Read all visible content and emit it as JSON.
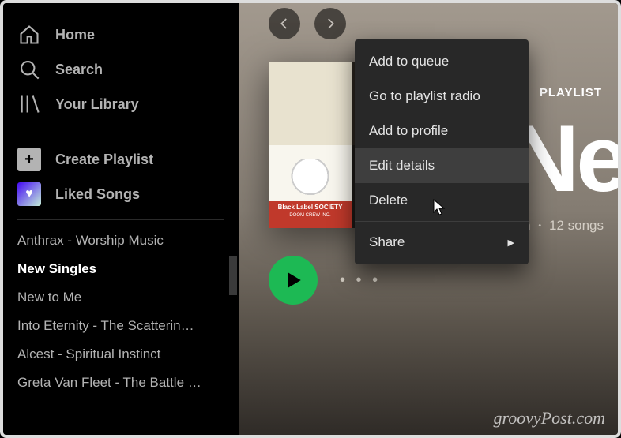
{
  "sidebar": {
    "nav": {
      "home": "Home",
      "search": "Search",
      "library": "Your Library"
    },
    "actions": {
      "create_playlist": "Create Playlist",
      "liked_songs": "Liked Songs"
    },
    "playlists": [
      "Anthrax - Worship Music",
      "New Singles",
      "New to Me",
      "Into Eternity - The Scatterin…",
      "Alcest - Spiritual Instinct",
      "Greta Van Fleet - The Battle …"
    ],
    "active_playlist_index": 1
  },
  "main": {
    "label": "PLAYLIST",
    "title": "Ne",
    "owner": "Brian",
    "song_count_text": "12 songs",
    "album_banner_line1": "Black Label",
    "album_banner_line2": "SOCIETY",
    "album_banner_line3": "DOOM CREW INC."
  },
  "context_menu": {
    "items": [
      "Add to queue",
      "Go to playlist radio",
      "Add to profile",
      "Edit details",
      "Delete",
      "Share"
    ],
    "highlighted_index": 3,
    "share_has_submenu": true
  },
  "watermark": "groovyPost.com"
}
